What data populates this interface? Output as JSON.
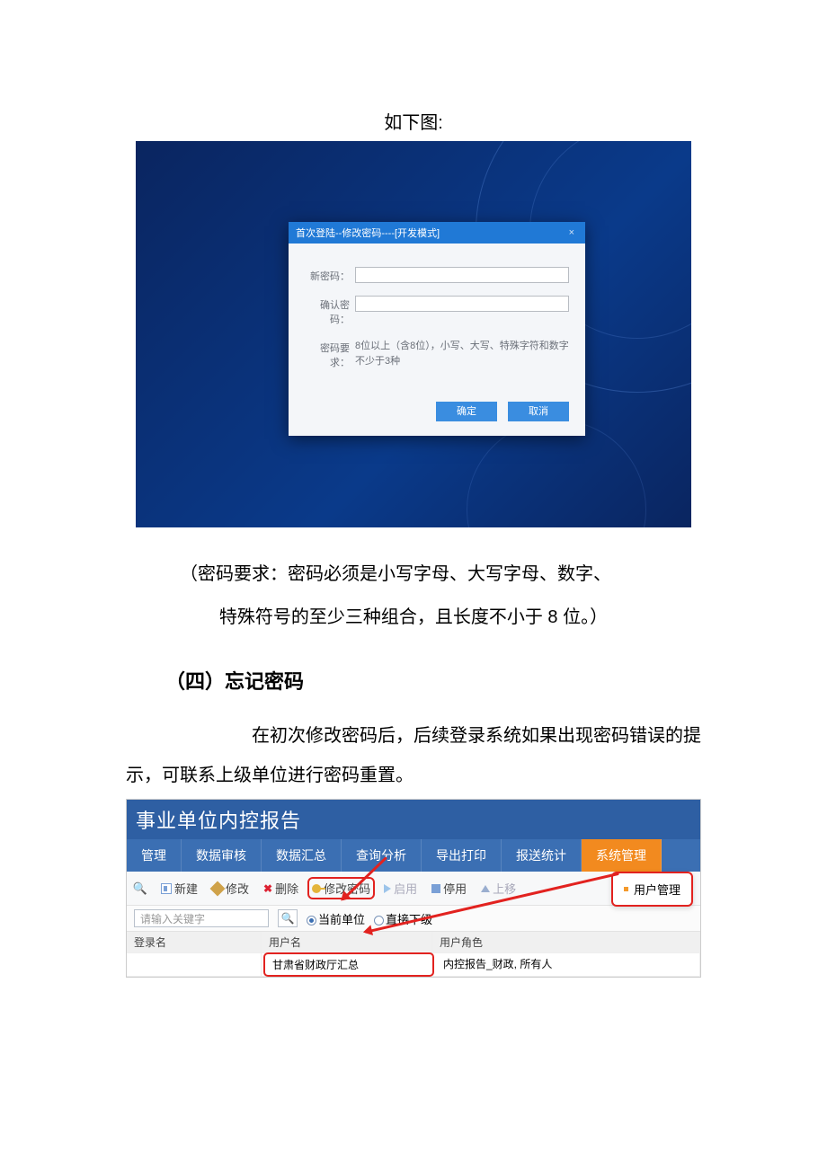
{
  "caption_top": "如下图:",
  "dialog": {
    "title": "首次登陆--修改密码----[开发模式]",
    "close": "×",
    "new_pwd_label": "新密码：",
    "confirm_pwd_label": "确认密码：",
    "req_label": "密码要求：",
    "req_text": "8位以上（含8位），小写、大写、特殊字符和数字不少于3种",
    "ok": "确定",
    "cancel": "取消"
  },
  "para_req": "（密码要求：密码必须是小写字母、大写字母、数字、",
  "para_req2": "特殊符号的至少三种组合，且长度不小于 8 位。）",
  "subhead": "（四）忘记密码",
  "para_body": "在初次修改密码后，后续登录系统如果出现密码错误的提示，可联系上级单位进行密码重置。",
  "fig2": {
    "title": "事业单位内控报告",
    "tabs": [
      "管理",
      "数据审核",
      "数据汇总",
      "查询分析",
      "导出打印",
      "报送统计",
      "系统管理"
    ],
    "toolbar": {
      "new": "新建",
      "edit": "修改",
      "delete": "删除",
      "chgpwd": "修改密码",
      "enable": "启用",
      "disable": "停用",
      "upload": "上移"
    },
    "popover": "用户管理",
    "filter": {
      "placeholder": "请输入关键字",
      "current": "当前单位",
      "child": "直接下级"
    },
    "table": {
      "headers": [
        "登录名",
        "用户名",
        "用户角色"
      ],
      "row": {
        "login": "",
        "user": "甘肃省财政厅汇总",
        "role": "内控报告_财政, 所有人"
      }
    }
  }
}
